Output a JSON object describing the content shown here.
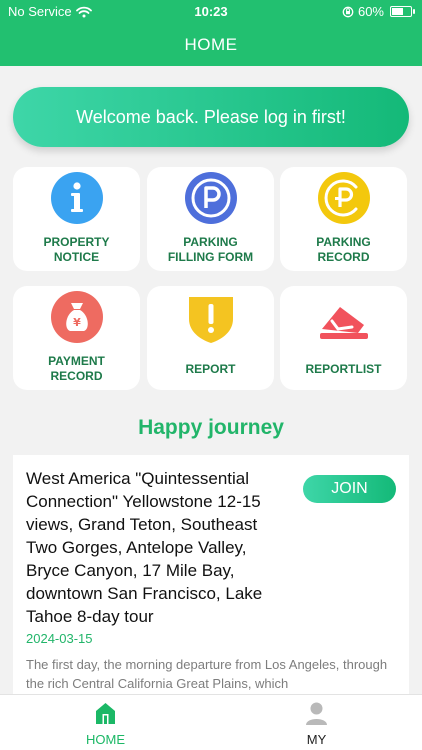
{
  "status_bar": {
    "carrier": "No Service",
    "time": "10:23",
    "battery": "60%",
    "battery_level": 0.6
  },
  "header": {
    "title": "HOME"
  },
  "welcome": {
    "text": "Welcome back. Please log in first!"
  },
  "tiles": [
    {
      "label": "PROPERTY\nNOTICE",
      "icon": "info-icon",
      "color": "#3aa3f1"
    },
    {
      "label": "PARKING\nFILLING FORM",
      "icon": "parking-icon",
      "color": "#4e6fdb"
    },
    {
      "label": "PARKING\nRECORD",
      "icon": "parking-record-icon",
      "color": "#f3c80d"
    },
    {
      "label": "PAYMENT\nRECORD",
      "icon": "money-bag-icon",
      "color": "#ee6b61"
    },
    {
      "label": "REPORT",
      "icon": "warning-shield-icon",
      "color": "#f4c421"
    },
    {
      "label": "REPORTLIST",
      "icon": "report-list-icon",
      "color": "#f1525c"
    }
  ],
  "section": {
    "title": "Happy journey"
  },
  "trip": {
    "title": "West America \"Quintessential Connection\" Yellowstone 12-15 views, Grand Teton, Southeast Two Gorges, Antelope Valley, Bryce Canyon, 17 Mile Bay, downtown San Francisco, Lake Tahoe 8-day tour",
    "join_label": "JOIN",
    "date": "2024-03-15",
    "description": "The first day, the morning departure from Los Angeles, through the rich Central California Great Plains, which"
  },
  "tabbar": {
    "items": [
      {
        "label": "HOME",
        "icon": "home-icon",
        "active": true
      },
      {
        "label": "MY",
        "icon": "user-icon",
        "active": false
      }
    ]
  },
  "colors": {
    "brand": "#22c070",
    "tile_text": "#1e7a4a",
    "accent_text": "#22b56a",
    "inactive_tab": "#222222",
    "background": "#f2f2f2"
  }
}
